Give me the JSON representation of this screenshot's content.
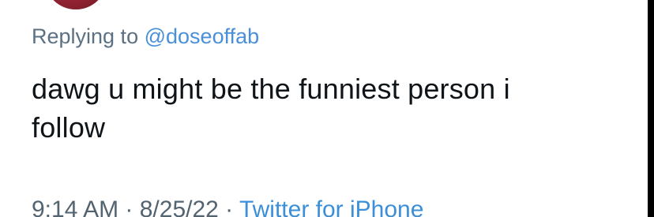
{
  "reply": {
    "prefix": "Replying to",
    "handle": "@doseoffab"
  },
  "tweet": {
    "line1": "dawg u might be the funniest person i",
    "line2": "follow"
  },
  "meta": {
    "time": "9:14 AM",
    "date": "8/25/22",
    "source": "Twitter for iPhone",
    "separator": " · "
  },
  "colors": {
    "link": "#3b8fd8",
    "text": "#0f1419",
    "secondary": "#5b7083"
  }
}
